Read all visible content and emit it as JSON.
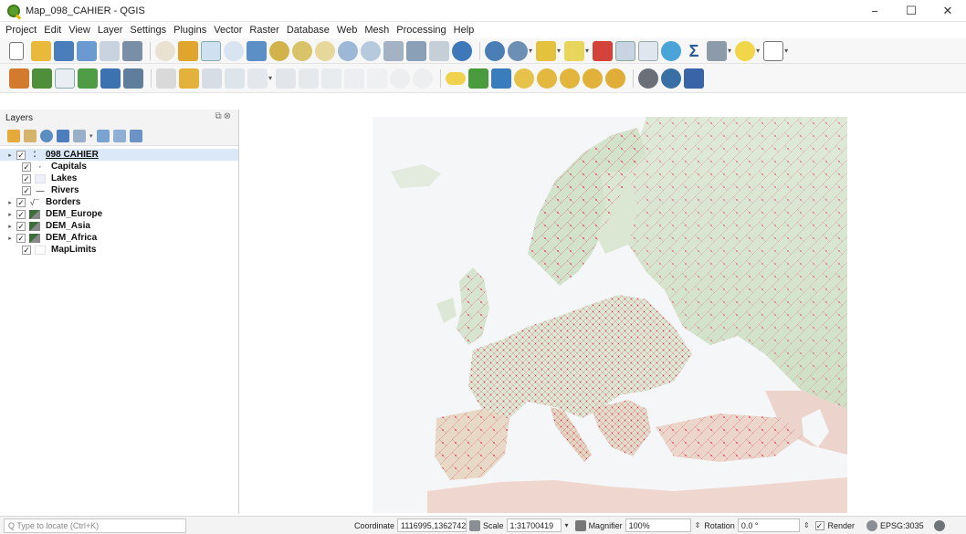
{
  "window": {
    "title": "Map_098_CAHIER - QGIS",
    "minimize": "−",
    "maximize": "☐",
    "close": "✕"
  },
  "menu": [
    "Project",
    "Edit",
    "View",
    "Layer",
    "Settings",
    "Plugins",
    "Vector",
    "Raster",
    "Database",
    "Web",
    "Mesh",
    "Processing",
    "Help"
  ],
  "layers_panel": {
    "title": "Layers",
    "layers": [
      {
        "name": "098 CAHIER",
        "checked": true,
        "expandable": true,
        "group": true,
        "symbol": "group-icon"
      },
      {
        "name": "Capitals",
        "checked": true,
        "expandable": false,
        "symbol": "point-symbol-icon"
      },
      {
        "name": "Lakes",
        "checked": true,
        "expandable": false,
        "symbol": "polygon-symbol-icon"
      },
      {
        "name": "Rivers",
        "checked": true,
        "expandable": false,
        "symbol": "line-symbol-icon"
      },
      {
        "name": "Borders",
        "checked": true,
        "expandable": true,
        "symbol": "line-rule-icon"
      },
      {
        "name": "DEM_Europe",
        "checked": true,
        "expandable": true,
        "symbol": "raster-icon"
      },
      {
        "name": "DEM_Asia",
        "checked": true,
        "expandable": true,
        "symbol": "raster-icon"
      },
      {
        "name": "DEM_Africa",
        "checked": true,
        "expandable": true,
        "symbol": "raster-icon"
      },
      {
        "name": "MapLimits",
        "checked": true,
        "expandable": false,
        "symbol": "polygon-symbol-icon"
      }
    ]
  },
  "statusbar": {
    "locator_placeholder": "Q  Type to locate (Ctrl+K)",
    "coordinate_label": "Coordinate",
    "coordinate_value": "1116995,1362742",
    "scale_label": "Scale",
    "scale_value": "1:31700419",
    "magnifier_label": "Magnifier",
    "magnifier_value": "100%",
    "rotation_label": "Rotation",
    "rotation_value": "0.0 °",
    "render_label": "Render",
    "render_checked": true,
    "crs": "EPSG:3035"
  },
  "colors": {
    "sea": "#f4f6f8",
    "land_low": "#dde9d6",
    "land_mid": "#c9dcc2",
    "land_high": "#e8c9c1",
    "border": "#d9445b",
    "selected_row": "#dbe8f7"
  }
}
